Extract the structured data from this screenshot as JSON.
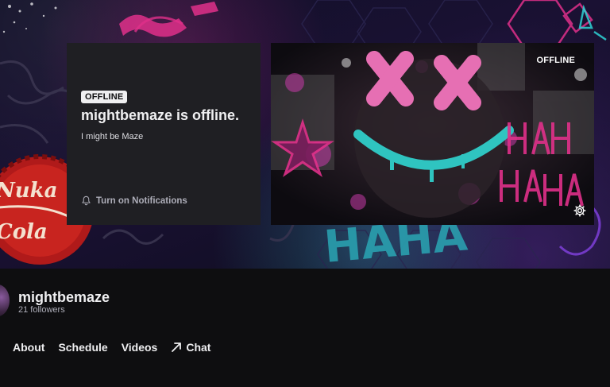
{
  "offline_card": {
    "badge": "OFFLINE",
    "title": "mightbemaze is offline.",
    "description": "I might be Maze",
    "notifications_label": "Turn on Notifications"
  },
  "preview": {
    "label": "OFFLINE"
  },
  "channel": {
    "name": "mightbemaze",
    "followers": "21 followers"
  },
  "tabs": [
    {
      "label": "About"
    },
    {
      "label": "Schedule"
    },
    {
      "label": "Videos"
    },
    {
      "label": "Chat",
      "icon": "external-arrow-icon"
    }
  ],
  "colors": {
    "background": "#0e0e10",
    "card": "#1f1f23",
    "text": "#efeff1",
    "muted": "#adadb8"
  }
}
